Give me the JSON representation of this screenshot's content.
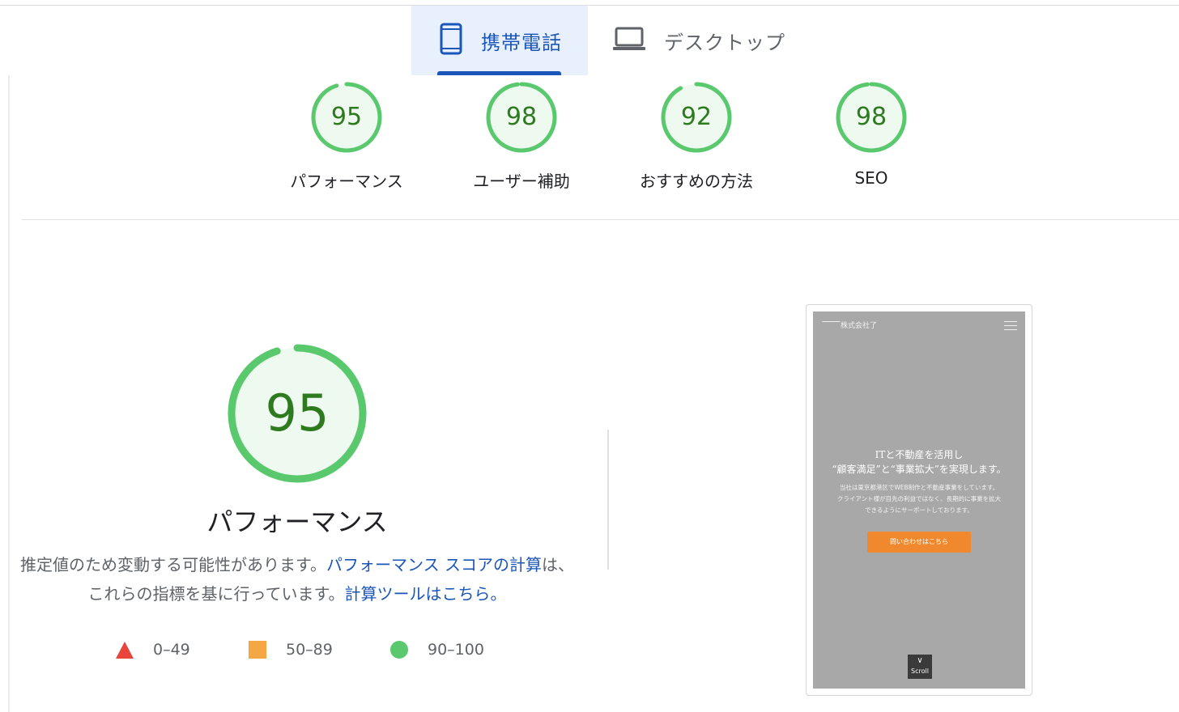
{
  "tabs": {
    "mobile_label": "携帯電話",
    "desktop_label": "デスクトップ",
    "active": "mobile"
  },
  "scores": [
    {
      "label": "パフォーマンス",
      "score": 95
    },
    {
      "label": "ユーザー補助",
      "score": 98
    },
    {
      "label": "おすすめの方法",
      "score": 92
    },
    {
      "label": "SEO",
      "score": 98
    }
  ],
  "performance": {
    "score": 95,
    "title": "パフォーマンス",
    "desc_text1": "推定値のため変動する可能性があります。",
    "desc_link1": "パフォーマンス スコアの計算",
    "desc_text2": "は、これらの指標を基に行っています。",
    "desc_link2": "計算ツールはこちら。"
  },
  "legend": [
    {
      "range": "0–49",
      "color": "#e8453c",
      "shape": "triangle"
    },
    {
      "range": "50–89",
      "color": "#f4a742",
      "shape": "square"
    },
    {
      "range": "90–100",
      "color": "#5ac96e",
      "shape": "circle"
    }
  ],
  "screenshot": {
    "logo_text": "株式会社了",
    "headline_1": "ITと不動産を活用し",
    "headline_2": "“顧客満足”と“事業拡大”を実現します。",
    "sub_1": "当社は東京都港区でWEB制作と不動産事業をしています。",
    "sub_2": "クライアント様が目先の利益ではなく、長期的に事業を拡大",
    "sub_3": "できるようにサーポートしております。",
    "button": "問い合わせはこちら",
    "scroll": "Scroll"
  },
  "colors": {
    "pass_ring": "#5ac96e",
    "pass_fill": "#eefaf0",
    "pass_text": "#2d7a1f",
    "accent": "#1a56b8"
  }
}
